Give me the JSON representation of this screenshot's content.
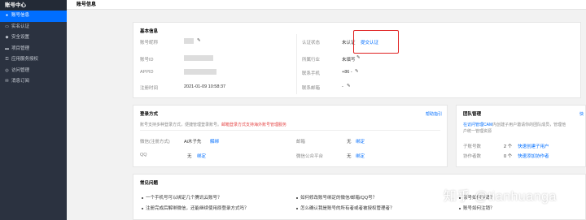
{
  "sidebar": {
    "title": "账号中心",
    "items": [
      {
        "label": "账号信息",
        "icon": "user-icon",
        "active": true
      },
      {
        "label": "实名认证",
        "icon": "id-card-icon",
        "active": false
      },
      {
        "label": "安全设置",
        "icon": "shield-icon",
        "active": false
      },
      {
        "label": "项目管理",
        "icon": "folder-icon",
        "active": false
      },
      {
        "label": "应用服务授权",
        "icon": "key-icon",
        "active": false
      },
      {
        "label": "访问管理",
        "icon": "access-icon",
        "active": false
      },
      {
        "label": "消息订阅",
        "icon": "mail-icon",
        "active": false
      }
    ]
  },
  "topbar": {
    "title": "账号信息"
  },
  "basic": {
    "title": "基本信息",
    "account_name_label": "账号昵称",
    "account_id_label": "账号ID",
    "appid_label": "APPID",
    "register_time_label": "注册时间",
    "register_time": "2021-01-09 10:58:37",
    "auth_status_label": "认证状态",
    "auth_status": "未认证",
    "auth_link": "提交认证",
    "industry_label": "所属行业",
    "industry": "未填写",
    "phone_label": "联系手机",
    "phone": "+86 -",
    "email_label": "联系邮箱",
    "email": "-"
  },
  "login": {
    "title": "登录方式",
    "help_link": "帮助指引",
    "desc": "账号支持多种登录方式，便捷管理登录账号。",
    "notice": "邮箱登录方式支持海外账号管理服务",
    "wechat_label": "微信(注册方式)",
    "wechat_value": "Ai木子先",
    "wechat_action": "解绑",
    "email_label": "邮箱",
    "email_value": "无",
    "email_action": "绑定",
    "qq_label": "QQ",
    "qq_value": "无",
    "qq_action": "绑定",
    "wxpub_label": "微信公众平台",
    "wxpub_value": "无",
    "wxpub_action": "绑定"
  },
  "team": {
    "title": "团队管理",
    "corner_link": "快",
    "desc_prefix": "在访问管理CAM",
    "desc_rest": "内创建子用户邀请你的团队成员，管理他",
    "desc_line2": "户统一管理资源",
    "subaccount_label": "子账号数",
    "subaccount_count": "2 个",
    "subaccount_link": "快速创建子用户",
    "collab_label": "协作者数",
    "collab_count": "0 个",
    "collab_link": "快速添加协作者"
  },
  "faq": {
    "title": "常见问题",
    "items": [
      "一个手机号可以绑定几个腾讯云账号？",
      "如何修改账号绑定的微信/邮箱/QQ号？",
      "账号如何注销？",
      "注册完成后解绑微信，还能继续使用原登录方式吗？",
      "怎么确认我是账号的所有者或者被授权管理者？",
      "账号如何注销？"
    ]
  },
  "watermark": "知乎 @tianhuanga"
}
